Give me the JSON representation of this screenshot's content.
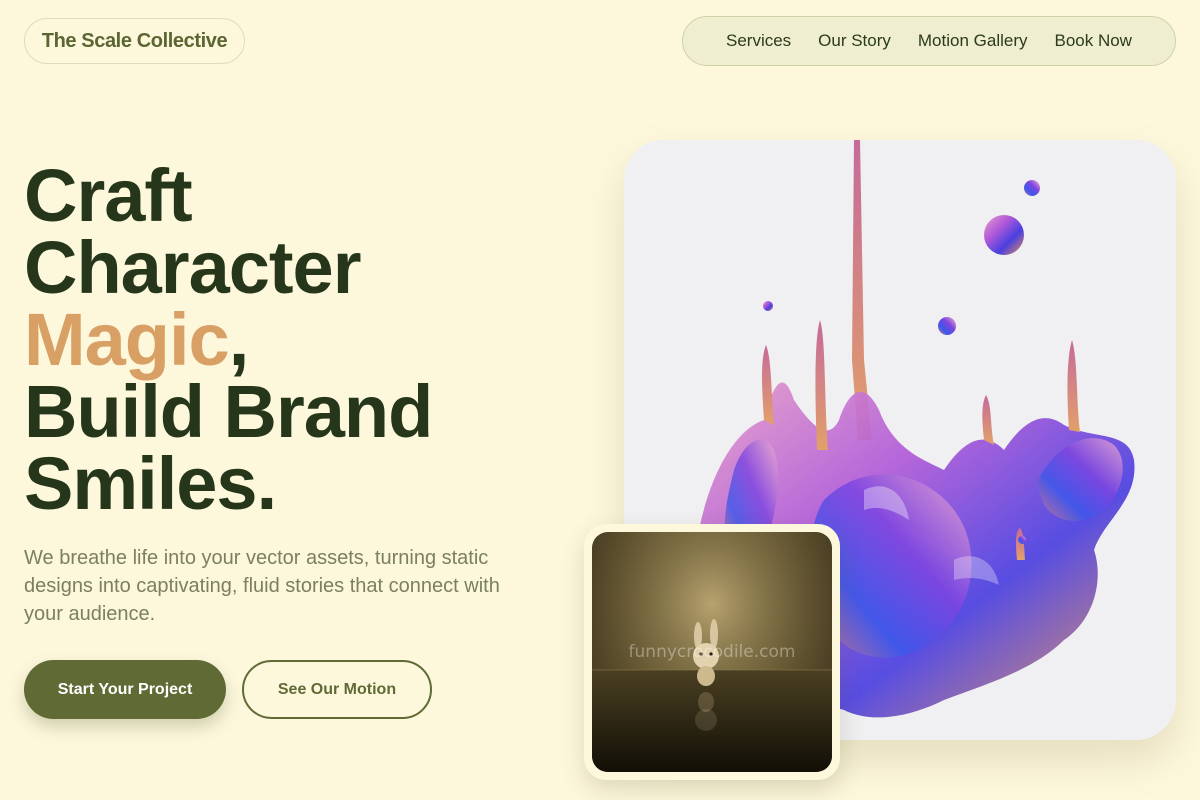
{
  "brand": {
    "name": "The Scale Collective"
  },
  "nav": {
    "items": [
      {
        "label": "Services"
      },
      {
        "label": "Our Story"
      },
      {
        "label": "Motion Gallery"
      },
      {
        "label": "Book Now"
      }
    ]
  },
  "hero": {
    "headline": {
      "line1": "Craft",
      "line2": "Character",
      "accent_word": "Magic",
      "accent_suffix": ",",
      "line4": "Build Brand",
      "line5": "Smiles."
    },
    "subtitle": "We breathe life into your vector assets, turning static designs into captivating, fluid stories that connect with your audience.",
    "primary_cta": "Start Your Project",
    "secondary_cta": "See Our Motion"
  },
  "media": {
    "thumb_watermark": "funnycrocodile.com"
  },
  "colors": {
    "background": "#fdf7dc",
    "primary": "#5f6a35",
    "headline": "#26361a",
    "accent": "#d9a066"
  }
}
